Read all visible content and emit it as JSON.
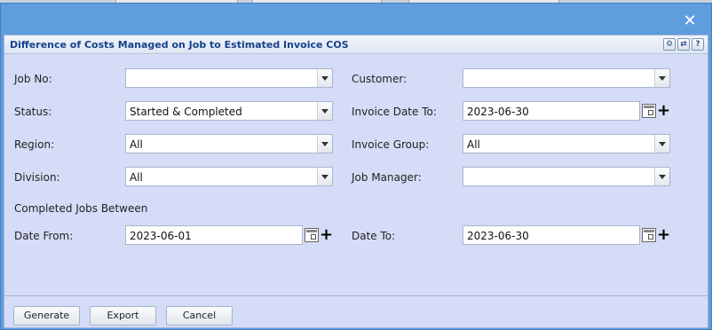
{
  "window": {
    "close_label": "✕"
  },
  "panel": {
    "title": "Difference of Costs Managed on Job to Estimated Invoice COS"
  },
  "form": {
    "job_no": {
      "label": "Job No:",
      "value": ""
    },
    "customer": {
      "label": "Customer:",
      "value": ""
    },
    "status": {
      "label": "Status:",
      "value": "Started & Completed"
    },
    "invoice_date_to": {
      "label": "Invoice Date To:",
      "value": "2023-06-30"
    },
    "region": {
      "label": "Region:",
      "value": "All"
    },
    "invoice_group": {
      "label": "Invoice Group:",
      "value": "All"
    },
    "division": {
      "label": "Division:",
      "value": "All"
    },
    "job_manager": {
      "label": "Job Manager:",
      "value": ""
    },
    "completed_section_label": "Completed Jobs Between",
    "date_from": {
      "label": "Date From:",
      "value": "2023-06-01"
    },
    "date_to": {
      "label": "Date To:",
      "value": "2023-06-30"
    }
  },
  "buttons": {
    "generate": "Generate",
    "export": "Export",
    "cancel": "Cancel"
  }
}
